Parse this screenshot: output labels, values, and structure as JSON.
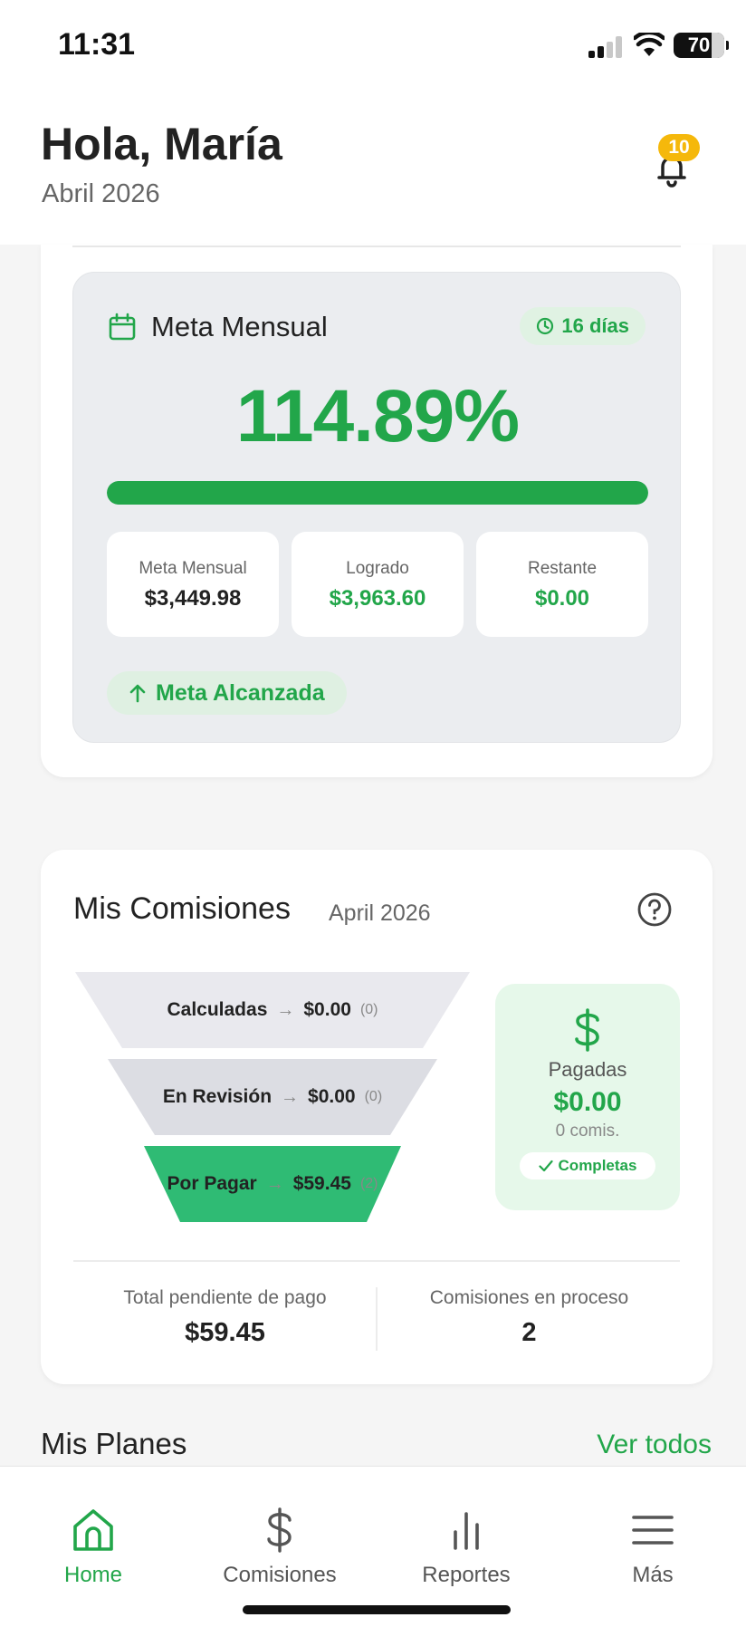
{
  "status_bar": {
    "time": "11:31",
    "battery": "70"
  },
  "header": {
    "greeting": "Hola, María",
    "month": "Abril 2026",
    "notification_count": "10"
  },
  "monthly_goal": {
    "title": "Meta Mensual",
    "days_left": "16 días",
    "percent": "114.89%",
    "progress": 1.0,
    "stats": [
      {
        "label": "Meta Mensual",
        "value": "$3,449.98",
        "color": "#222222"
      },
      {
        "label": "Logrado",
        "value": "$3,963.60",
        "color": "#22a64a"
      },
      {
        "label": "Restante",
        "value": "$0.00",
        "color": "#22a64a"
      }
    ],
    "status_label": "Meta Alcanzada"
  },
  "commissions": {
    "title": "Mis Comisiones",
    "month": "April 2026",
    "funnel": [
      {
        "label": "Calculadas",
        "amount": "$0.00",
        "count": "(0)",
        "color": "#e9e9ee"
      },
      {
        "label": "En Revisión",
        "amount": "$0.00",
        "count": "(0)",
        "color": "#dcdde3"
      },
      {
        "label": "Por Pagar",
        "amount": "$59.45",
        "count": "(2)",
        "color": "#2fbb74"
      }
    ],
    "paid": {
      "label": "Pagadas",
      "amount": "$0.00",
      "count": "0 comis.",
      "status": "Completas"
    },
    "summary": [
      {
        "label": "Total pendiente de pago",
        "value": "$59.45"
      },
      {
        "label": "Comisiones en proceso",
        "value": "2"
      }
    ]
  },
  "plans": {
    "title": "Mis Planes",
    "link": "Ver todos"
  },
  "tabs": [
    {
      "label": "Home",
      "icon": "home-icon",
      "active": true
    },
    {
      "label": "Comisiones",
      "icon": "dollar-icon",
      "active": false
    },
    {
      "label": "Reportes",
      "icon": "bar-chart-icon",
      "active": false
    },
    {
      "label": "Más",
      "icon": "menu-icon",
      "active": false
    }
  ],
  "colors": {
    "accent": "#22a64a",
    "badge": "#f5b80b"
  }
}
